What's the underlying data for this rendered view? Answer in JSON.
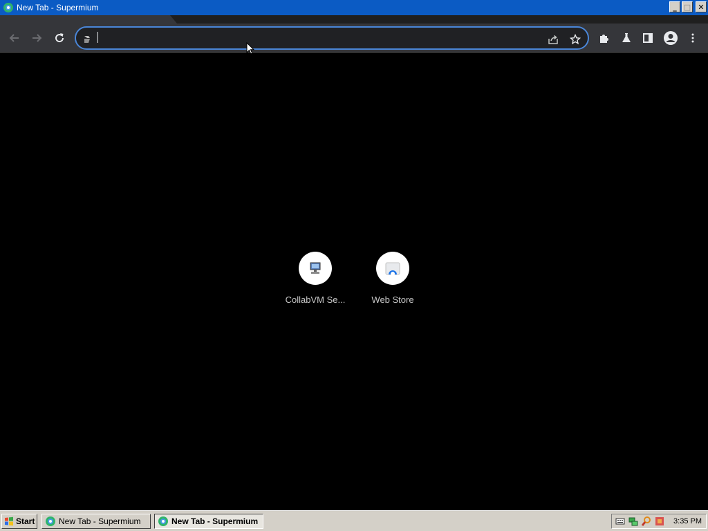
{
  "window": {
    "title": "New Tab - Supermium",
    "minimize": "_",
    "maximize": "□",
    "close": "✕"
  },
  "toolbar": {
    "omnibox_value": "",
    "icons": [
      "back-icon",
      "forward-icon",
      "reload-icon",
      "site-info-icon",
      "share-icon",
      "bookmark-star-icon",
      "extensions-icon",
      "labs-icon",
      "side-panel-icon",
      "profile-icon",
      "menu-icon"
    ]
  },
  "shortcuts": [
    {
      "label": "CollabVM Se...",
      "icon": "collabvm-icon"
    },
    {
      "label": "Web Store",
      "icon": "web-store-icon"
    }
  ],
  "taskbar": {
    "start_label": "Start",
    "tasks": [
      {
        "label": "New Tab - Supermium",
        "active": false
      },
      {
        "label": "New Tab - Supermium",
        "active": true
      }
    ],
    "clock": "3:35 PM",
    "tray_icons": [
      "keyboard-icon",
      "network-icon",
      "search-icon",
      "app-icon"
    ]
  },
  "colors": {
    "titlebar": "#0b5bc4",
    "toolbar": "#35363a",
    "omnibox_border": "#4a86d8",
    "content_bg": "#000000",
    "taskbar": "#d4d0c8"
  }
}
